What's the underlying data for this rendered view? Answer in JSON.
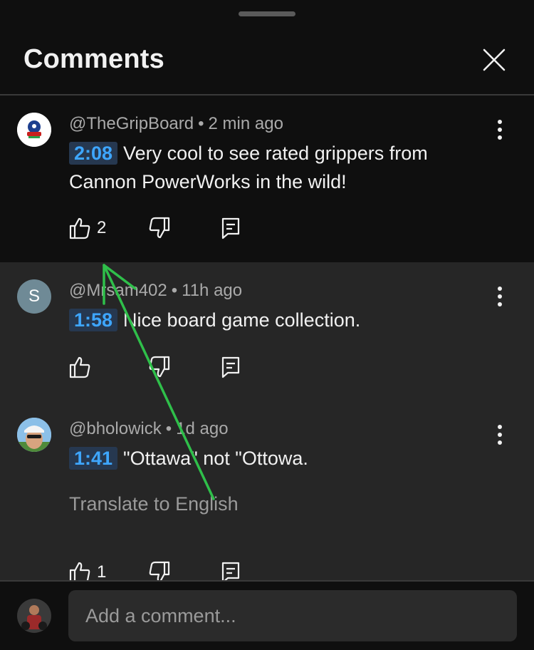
{
  "header": {
    "title": "Comments"
  },
  "comments": [
    {
      "author": "@TheGripBoard",
      "time": "2 min ago",
      "timestamp": "2:08",
      "text": "Very cool to see rated grippers from Cannon PowerWorks in the wild!",
      "likes": "2"
    },
    {
      "author": "@Mrsam402",
      "time": "11h ago",
      "avatar_letter": "S",
      "avatar_color": "#6f8a96",
      "timestamp": "1:58",
      "text": "Nice board game collection."
    },
    {
      "author": "@bholowick",
      "time": "1d ago",
      "timestamp": "1:41",
      "text": "\"Ottawa\"  not \"Ottowa.",
      "translate": "Translate to English",
      "likes": "1"
    }
  ],
  "composer": {
    "placeholder": "Add a comment..."
  },
  "colors": {
    "timestamp_text": "#3ea6ff",
    "timestamp_bg": "#263850",
    "annotation_arrow": "#2fbf4a"
  }
}
